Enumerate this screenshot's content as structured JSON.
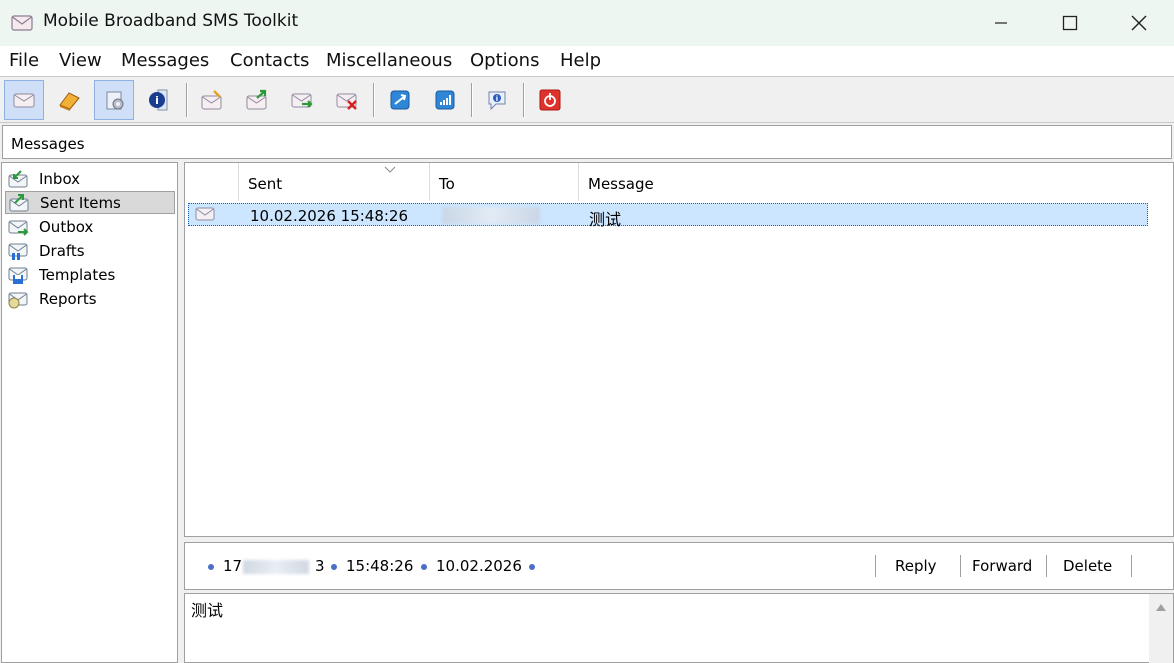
{
  "window": {
    "title": "Mobile Broadband SMS Toolkit",
    "controls": [
      "minimize",
      "maximize",
      "close"
    ]
  },
  "menu": [
    "File",
    "View",
    "Messages",
    "Contacts",
    "Miscellaneous",
    "Options",
    "Help"
  ],
  "toolbar": {
    "buttons": [
      {
        "name": "messages-view-icon",
        "pressed": true
      },
      {
        "name": "contacts-view-icon",
        "pressed": false
      },
      {
        "name": "settings-view-icon",
        "pressed": true
      },
      {
        "name": "info-view-icon",
        "pressed": false
      },
      {
        "name": "new-message-icon",
        "pressed": false
      },
      {
        "name": "send-message-icon",
        "pressed": false
      },
      {
        "name": "receive-message-icon",
        "pressed": false
      },
      {
        "name": "delete-message-icon",
        "pressed": false
      },
      {
        "name": "connect-icon",
        "pressed": false
      },
      {
        "name": "signal-icon",
        "pressed": false
      },
      {
        "name": "about-icon",
        "pressed": false
      },
      {
        "name": "exit-icon",
        "pressed": false
      }
    ]
  },
  "section": {
    "title": "Messages"
  },
  "sidebar": {
    "items": [
      {
        "label": "Inbox",
        "icon": "inbox-icon",
        "selected": false
      },
      {
        "label": "Sent Items",
        "icon": "sent-items-icon",
        "selected": true
      },
      {
        "label": "Outbox",
        "icon": "outbox-icon",
        "selected": false
      },
      {
        "label": "Drafts",
        "icon": "drafts-icon",
        "selected": false
      },
      {
        "label": "Templates",
        "icon": "templates-icon",
        "selected": false
      },
      {
        "label": "Reports",
        "icon": "reports-icon",
        "selected": false
      }
    ]
  },
  "list": {
    "columns": [
      "",
      "Sent",
      "To",
      "Message"
    ],
    "rows": [
      {
        "sent": "10.02.2026 15:48:26",
        "to": "",
        "message": "测试"
      }
    ]
  },
  "detail": {
    "number_prefix": "17",
    "number_suffix": "3",
    "time": "15:48:26",
    "date": "10.02.2026",
    "reply": "Reply",
    "forward": "Forward",
    "delete": "Delete"
  },
  "body": {
    "text": "测试"
  },
  "colors": {
    "titlebar": "#eef6f2",
    "selection": "#cce6ff",
    "accent": "#4a6fc4",
    "exit_red": "#e0322c"
  }
}
